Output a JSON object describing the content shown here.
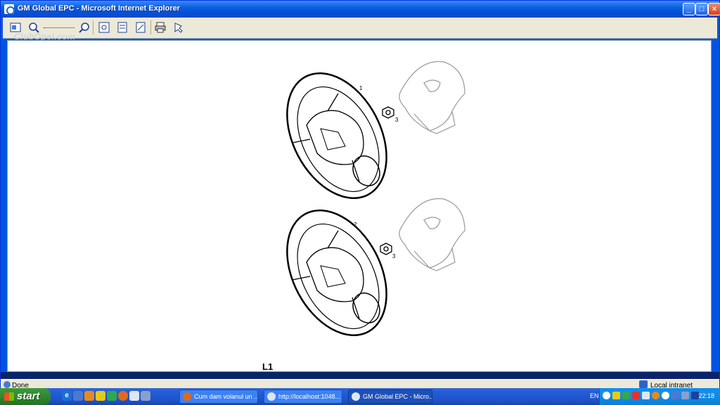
{
  "window": {
    "title": "GM Global EPC - Microsoft Internet Explorer",
    "buttons": {
      "minimize": "_",
      "maximize": "□",
      "close": "×"
    }
  },
  "toolbar": {
    "watermark": "ClubOpel.com",
    "icons": [
      "home-icon",
      "zoom-out-icon",
      "zoom-slider",
      "zoom-in-icon",
      "fit-page-icon",
      "find-icon",
      "notes-icon",
      "print-icon",
      "select-icon"
    ]
  },
  "diagram": {
    "callouts": [
      "1",
      "3",
      "2",
      "3"
    ],
    "label": "L1"
  },
  "status": {
    "text": "Done",
    "zone": "Local intranet"
  },
  "taskbar": {
    "start_label": "start",
    "tasks": [
      {
        "label": "Cum dam volanul un ...",
        "icon": "firefox-icon"
      },
      {
        "label": "http://localhost:1048...",
        "icon": "ie-icon"
      },
      {
        "label": "GM Global EPC - Micro...",
        "icon": "ie-icon"
      }
    ],
    "language": "EN",
    "clock": "22:18"
  },
  "colors": {
    "titlebar": "#0a5fdc",
    "taskbar": "#245edb",
    "start": "#2f8a2f",
    "tray": "#1290e8"
  }
}
